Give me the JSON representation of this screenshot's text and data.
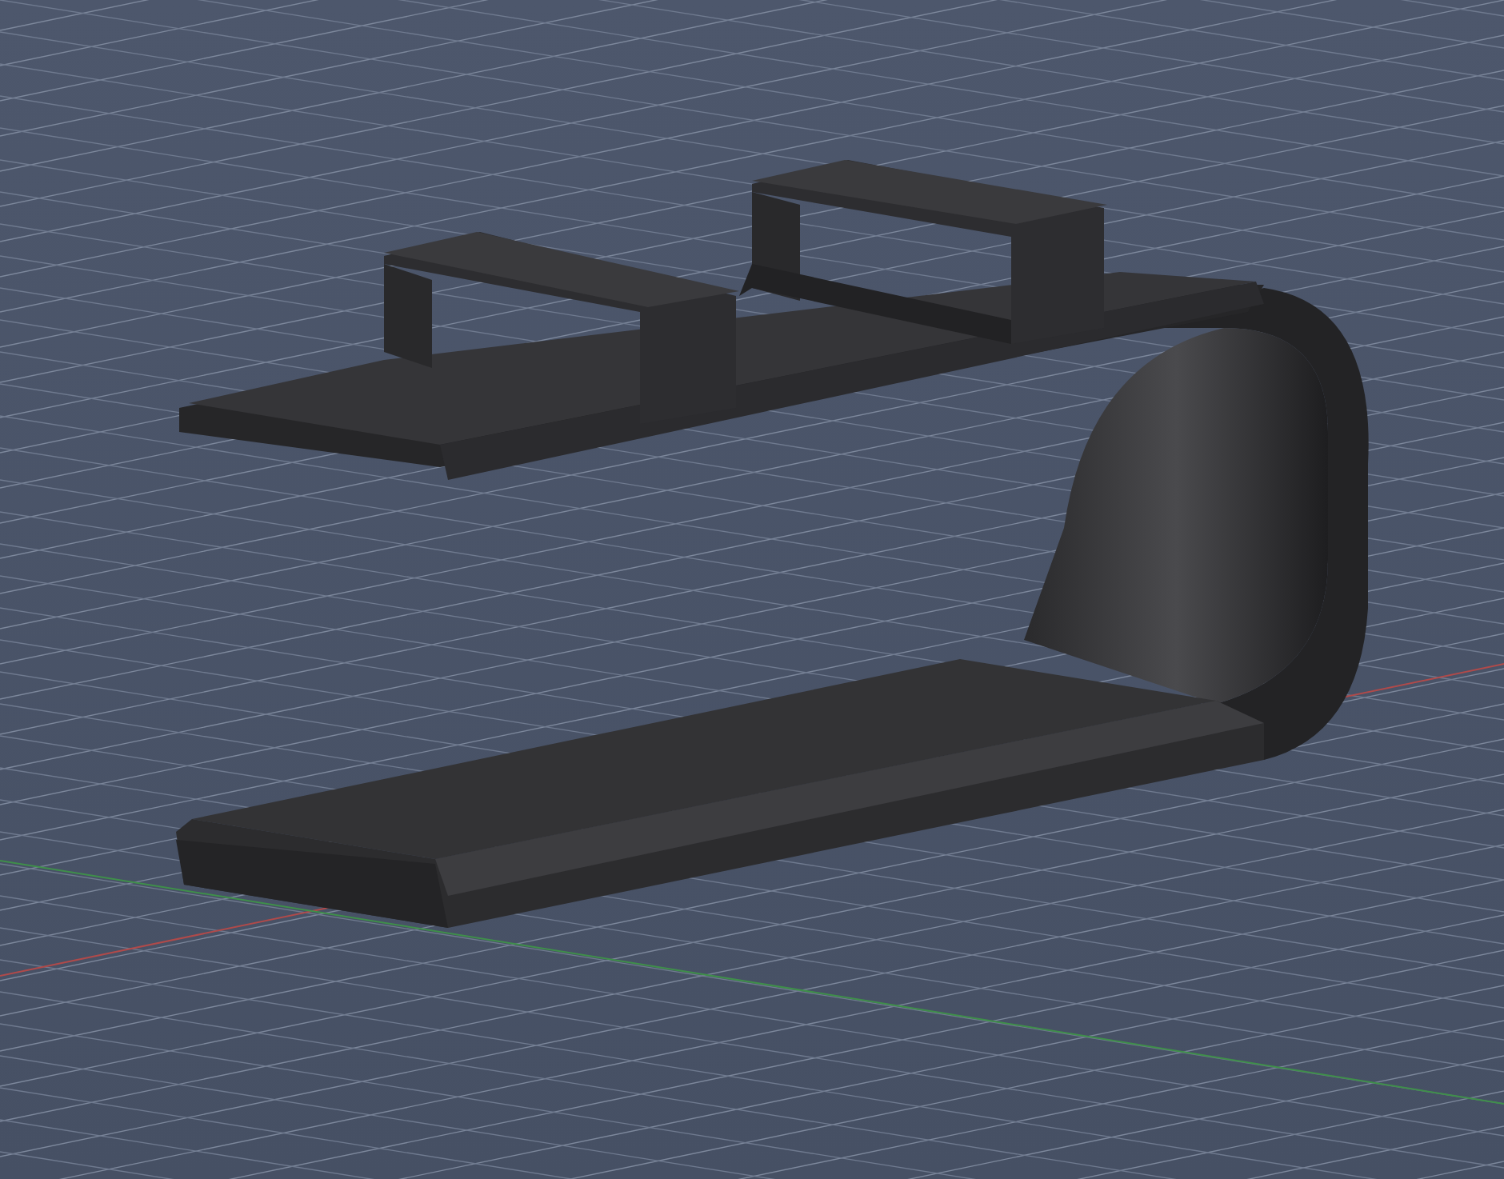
{
  "viewport": {
    "axes": [
      {
        "kind": "x",
        "color": "#b04a4a"
      },
      {
        "kind": "y",
        "color": "#3f8f4a"
      }
    ]
  }
}
